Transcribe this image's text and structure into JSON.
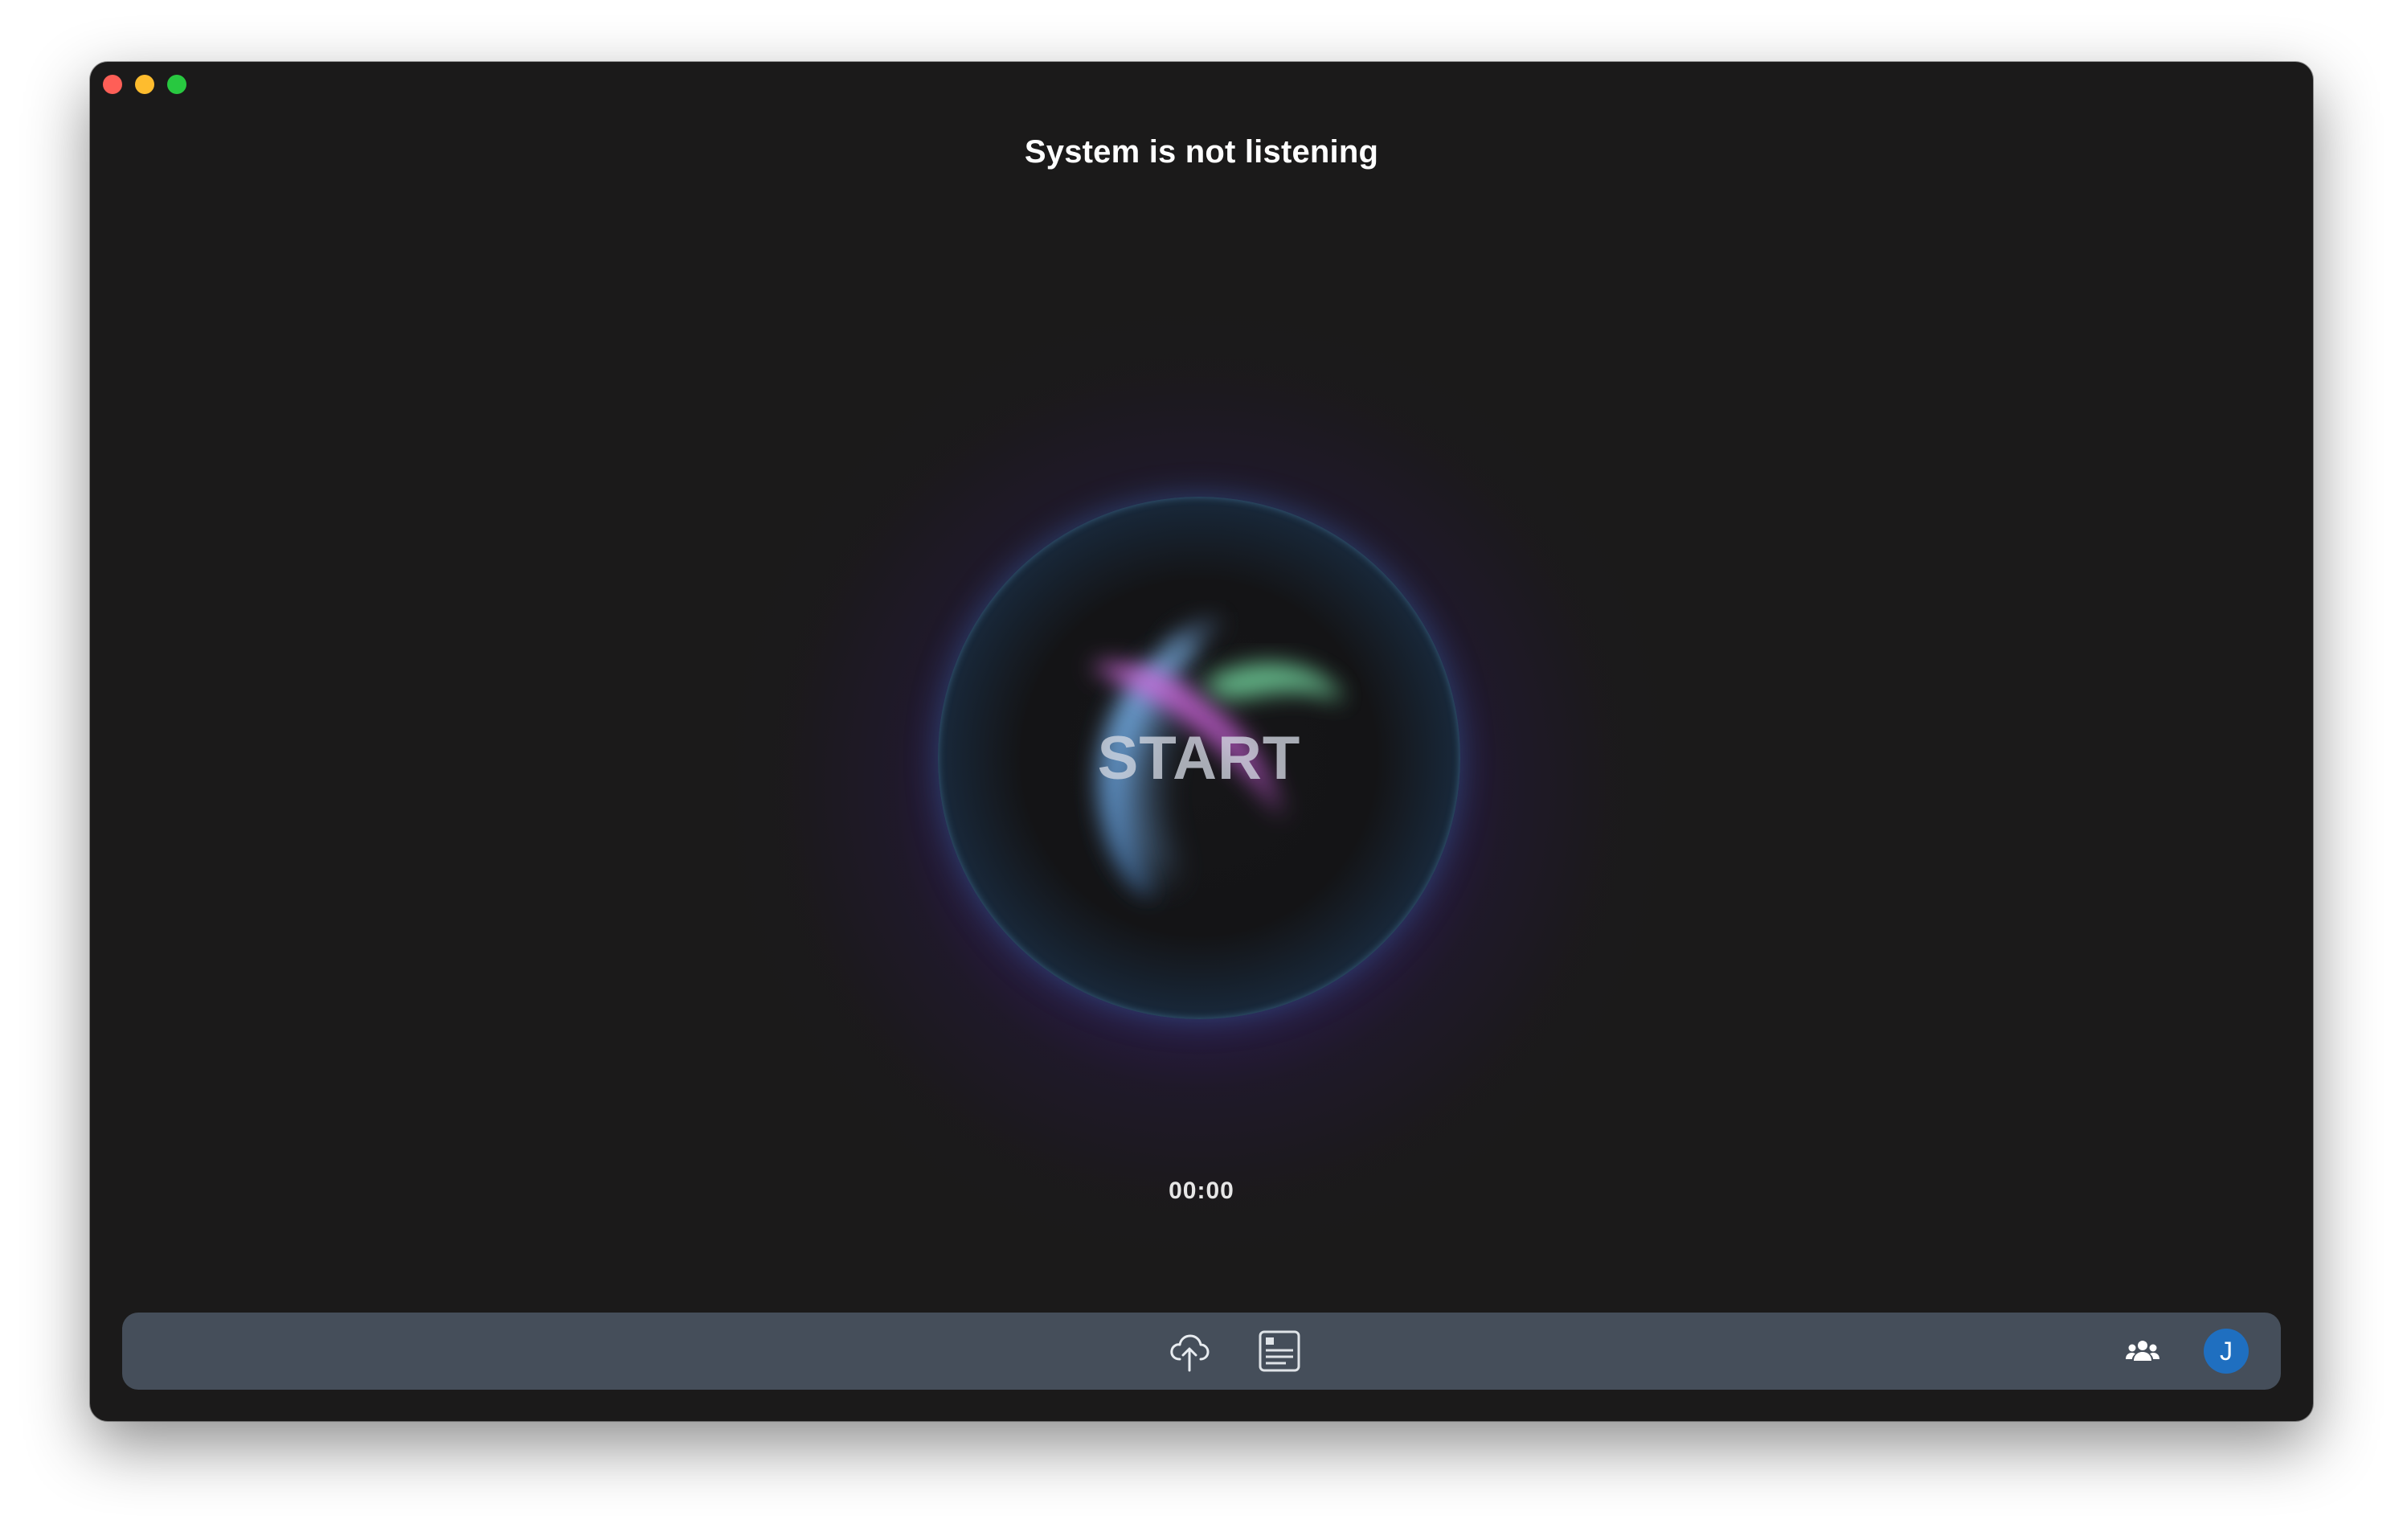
{
  "window": {
    "controls": [
      "close",
      "minimize",
      "maximize"
    ]
  },
  "status": {
    "title": "System is not listening"
  },
  "orb": {
    "label": "START",
    "ring_color": "#3897d8",
    "halo_color": "#5a28be"
  },
  "timer": {
    "value": "00:00"
  },
  "toolbar": {
    "icons": [
      "cloud-upload-icon",
      "transcript-icon",
      "team-icon"
    ],
    "avatar_initial": "J",
    "avatar_color": "#1f6fc0"
  }
}
